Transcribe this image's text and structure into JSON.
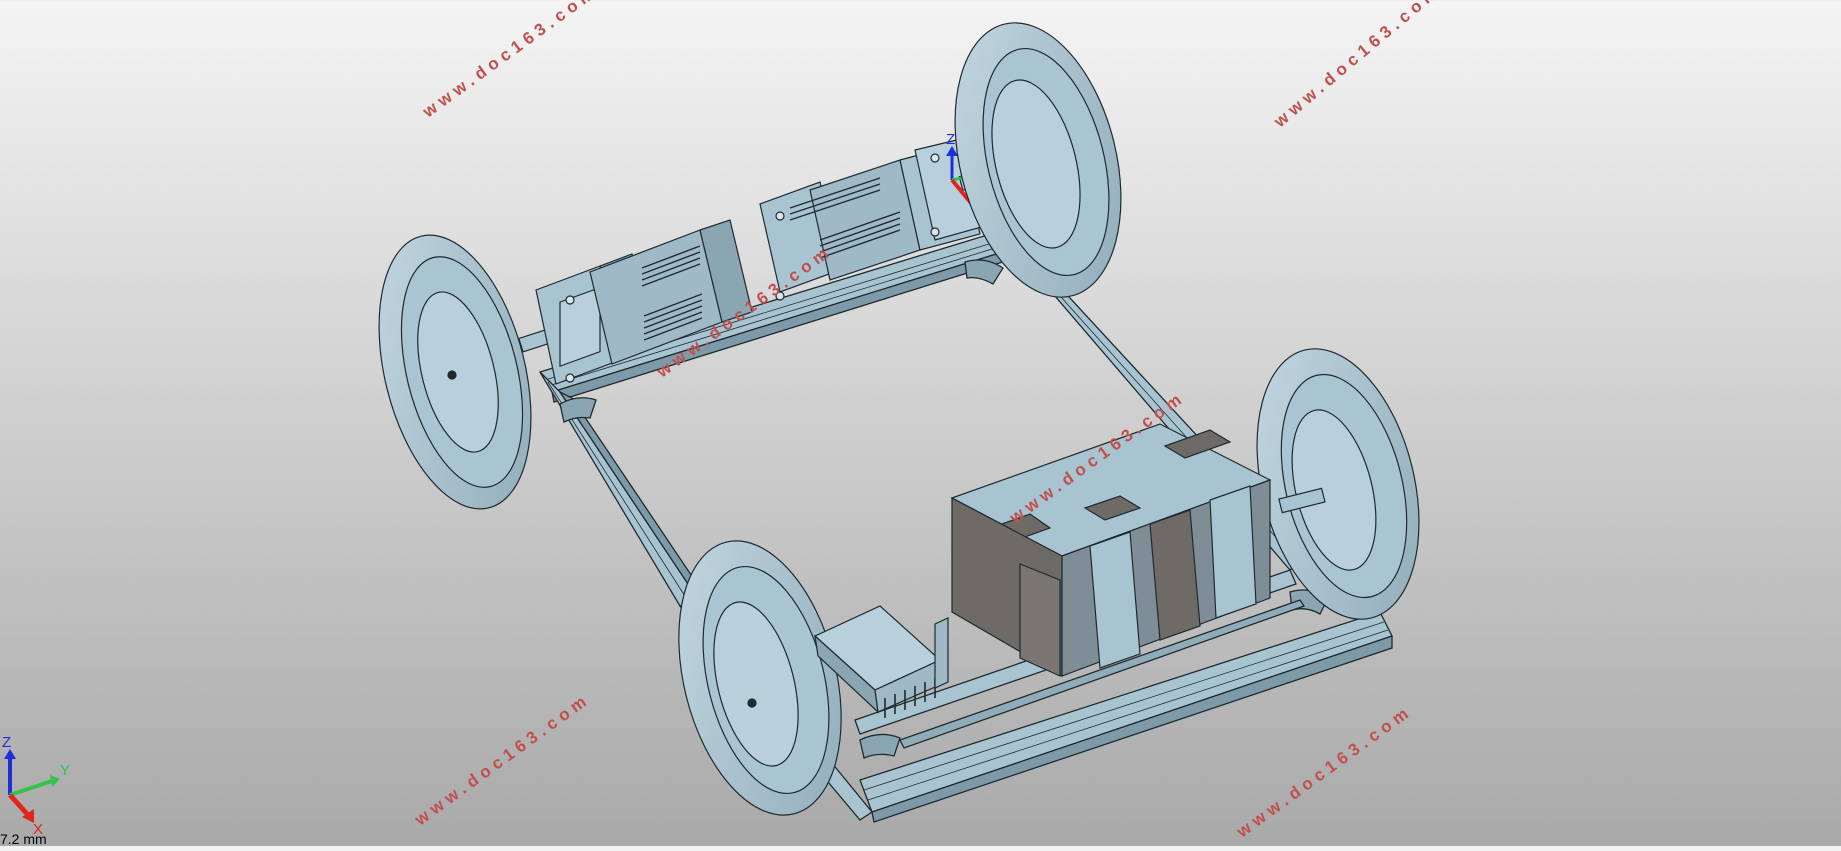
{
  "viewport": {
    "watermarks": [
      "www.doc163.com",
      "www.doc163.com",
      "www.doc163.com",
      "www.doc163.com",
      "www.doc163.com",
      "www.doc163.com",
      "www.doc163.com"
    ],
    "manipulator_z_label": "Z"
  },
  "triad": {
    "z_label": "Z",
    "y_label": "Y",
    "x_label": "X",
    "scale_label": "7.2 mm"
  },
  "colors": {
    "part": "#a9c4d1",
    "part_dark": "#7e9aa8",
    "edge": "#1e2a30",
    "battery_dark": "#6e6a66",
    "watermark": "#c0504d"
  },
  "icons": [
    "wheel-icon",
    "motor-icon",
    "battery-pack-icon",
    "controller-icon",
    "axis-triad-icon"
  ]
}
